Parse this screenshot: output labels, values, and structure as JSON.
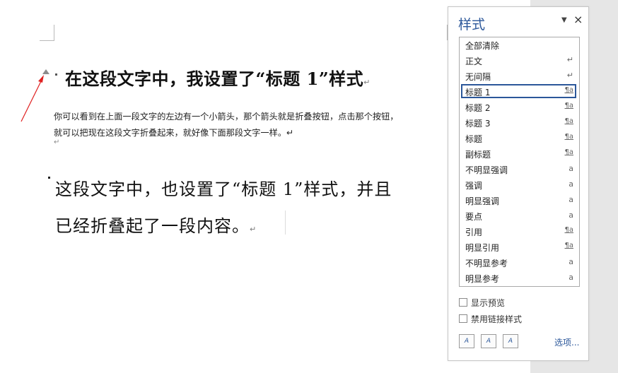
{
  "document": {
    "heading1": {
      "text": "在这段文字中，我设置了“标题 1”样式",
      "mark": "↵"
    },
    "body_lines": [
      "你可以看到在上面一段文字的左边有一个小箭头，那个箭头就是折叠按钮，点击那个按钮，",
      "就可以把现在这段文字折叠起来，就好像下面那段文字一样。↵",
      "↵"
    ],
    "heading2": {
      "line1": "这段文字中，也设置了“标题 1”样式，并且",
      "line2": "已经折叠起了一段内容。",
      "mark": "↵"
    }
  },
  "styles_pane": {
    "title": "样式",
    "menu_icon": "▼",
    "close_icon": "×",
    "items": [
      {
        "label": "全部清除",
        "glyph": ""
      },
      {
        "label": "正文",
        "glyph": "↵"
      },
      {
        "label": "无间隔",
        "glyph": "↵"
      },
      {
        "label": "标题 1",
        "glyph": "¶a",
        "selected": true
      },
      {
        "label": "标题 2",
        "glyph": "¶a"
      },
      {
        "label": "标题 3",
        "glyph": "¶a"
      },
      {
        "label": "标题",
        "glyph": "¶a"
      },
      {
        "label": "副标题",
        "glyph": "¶a"
      },
      {
        "label": "不明显强调",
        "glyph": "a"
      },
      {
        "label": "强调",
        "glyph": "a"
      },
      {
        "label": "明显强调",
        "glyph": "a"
      },
      {
        "label": "要点",
        "glyph": "a"
      },
      {
        "label": "引用",
        "glyph": "¶a"
      },
      {
        "label": "明显引用",
        "glyph": "¶a"
      },
      {
        "label": "不明显参考",
        "glyph": "a"
      },
      {
        "label": "明显参考",
        "glyph": "a"
      }
    ],
    "show_preview": {
      "label": "显示预览",
      "checked": false
    },
    "disable_linked": {
      "label": "禁用链接样式",
      "checked": false
    },
    "buttons": [
      {
        "icon": "new-style-icon",
        "text": "A"
      },
      {
        "icon": "style-inspector-icon",
        "text": "A"
      },
      {
        "icon": "manage-styles-icon",
        "text": "A"
      }
    ],
    "options_link": "选项..."
  },
  "colors": {
    "accent": "#2b579a",
    "annotation_arrow": "#e02020"
  }
}
